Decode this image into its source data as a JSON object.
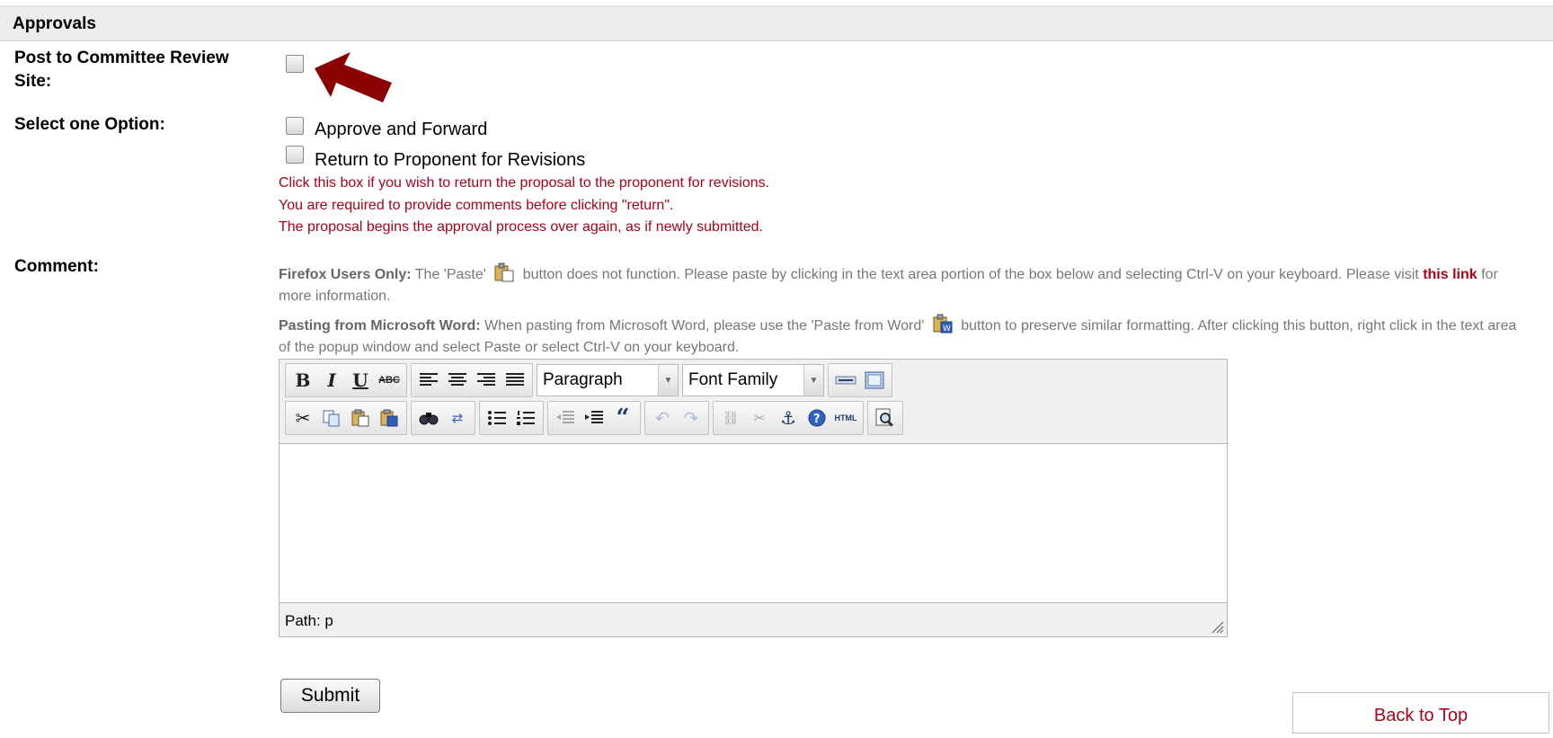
{
  "section": {
    "title": "Approvals"
  },
  "post_review": {
    "label": "Post to Committee Review Site:",
    "checked": false
  },
  "options": {
    "label": "Select one Option:",
    "items": [
      {
        "label": "Approve and Forward",
        "checked": false
      },
      {
        "label": "Return to Proponent for Revisions",
        "checked": false
      }
    ],
    "notes": [
      "Click this box if you wish to return the proposal to the proponent for revisions.",
      "You are required to provide comments before clicking \"return\".",
      "The proposal begins the approval process over again, as if newly submitted."
    ]
  },
  "comment": {
    "label": "Comment:",
    "firefox": {
      "heading": "Firefox Users Only:",
      "text1": "The 'Paste'",
      "text2": "button does not function. Please paste by clicking in the text area portion of the box below and selecting Ctrl-V on your keyboard. Please visit",
      "link": "this link",
      "text3": "for more information."
    },
    "word": {
      "heading": "Pasting from Microsoft Word:",
      "text1": "When pasting from Microsoft Word, please use the 'Paste from Word'",
      "text2": "button to preserve similar formatting. After clicking this button, right click in the text area of the popup window and select Paste or select Ctrl-V on your keyboard."
    }
  },
  "editor": {
    "format_select": "Paragraph",
    "font_select": "Font Family",
    "path_label": "Path: p",
    "content": ""
  },
  "actions": {
    "submit": "Submit",
    "back_to_top": "Back to Top"
  },
  "colors": {
    "accent_red": "#b00018",
    "arrow": "#8b0000"
  }
}
